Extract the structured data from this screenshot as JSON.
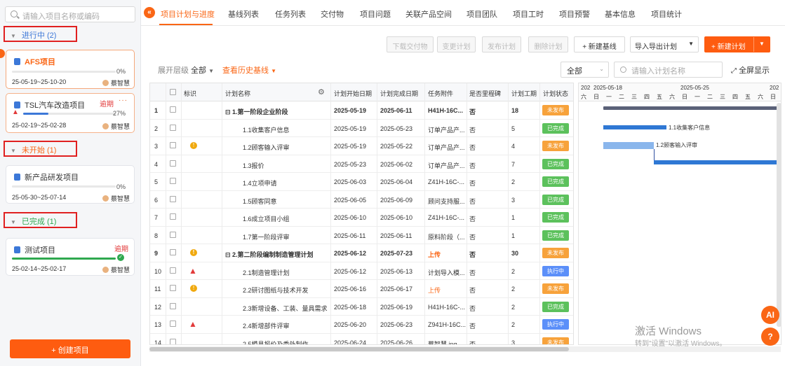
{
  "sidebar": {
    "search_placeholder": "请输入项目名称或编码",
    "groups": [
      {
        "label": "进行中 (2)",
        "color": "#3c78d8"
      },
      {
        "label": "未开始 (1)",
        "color": "#fa6615"
      },
      {
        "label": "已完成 (1)",
        "color": "#2fa84f"
      }
    ],
    "projects": [
      {
        "name": "AFS项目",
        "pct": "0%",
        "progress": 0,
        "dates": "25-05-19~25-10-20",
        "owner": "蔡智慧"
      },
      {
        "name": "TSL汽车改造项目",
        "pct": "27%",
        "progress": 0.27,
        "dates": "25-02-19~25-02-28",
        "owner": "蔡智慧",
        "tag": "逾期",
        "more": "···"
      },
      {
        "name": "新产品研发项目",
        "pct": "0%",
        "progress": 0,
        "dates": "25-05-30~25-07-14",
        "owner": "蔡智慧"
      },
      {
        "name": "测试项目",
        "progress": 1,
        "dates": "25-02-14~25-02-17",
        "owner": "蔡智慧",
        "tag": "逾期"
      }
    ],
    "create_label": "+ 创建项目"
  },
  "tabs": [
    "项目计划与进度",
    "基线列表",
    "任务列表",
    "交付物",
    "项目问题",
    "关联产品空间",
    "项目团队",
    "项目工时",
    "项目预警",
    "基本信息",
    "项目统计"
  ],
  "toolbar": {
    "download": "下载交付物",
    "change": "变更计划",
    "publish": "发布计划",
    "delete": "删除计划",
    "new_baseline": "+ 新建基线",
    "import_export": "导入导出计划",
    "new_plan": "+ 新建计划"
  },
  "filter": {
    "expand_label": "展开层级",
    "expand_value": "全部",
    "history": "查看历史基线",
    "status_value": "全部",
    "search_placeholder": "请输入计划名称",
    "fullscreen": "全屏显示"
  },
  "table": {
    "headers": [
      "",
      "标识",
      "计划名称",
      "计划开始日期",
      "计划完成日期",
      "任务附件",
      "是否里程碑",
      "计划工期",
      "计划状态"
    ],
    "rows": [
      {
        "no": "1",
        "flag": "",
        "name": "⊟ 1.第一阶段企业阶段",
        "start": "2025-05-19",
        "end": "2025-06-11",
        "attach": "H41H-16C...",
        "ms": "否",
        "dur": "18",
        "status": "未发布",
        "parent": true
      },
      {
        "no": "2",
        "flag": "",
        "name": "1.1收集客户信息",
        "start": "2025-05-19",
        "end": "2025-05-23",
        "attach": "订单产品产...",
        "ms": "否",
        "dur": "5",
        "status": "已完成"
      },
      {
        "no": "3",
        "flag": "warn",
        "name": "1.2顾客输入评审",
        "start": "2025-05-19",
        "end": "2025-05-22",
        "attach": "订单产品产...",
        "ms": "否",
        "dur": "4",
        "status": "未发布"
      },
      {
        "no": "4",
        "flag": "",
        "name": "1.3报价",
        "start": "2025-05-23",
        "end": "2025-06-02",
        "attach": "订单产品产...",
        "ms": "否",
        "dur": "7",
        "status": "已完成"
      },
      {
        "no": "5",
        "flag": "",
        "name": "1.4立项申请",
        "start": "2025-06-03",
        "end": "2025-06-04",
        "attach": "Z41H-16C-...",
        "ms": "否",
        "dur": "2",
        "status": "已完成"
      },
      {
        "no": "6",
        "flag": "",
        "name": "1.5顾客同意",
        "start": "2025-06-05",
        "end": "2025-06-09",
        "attach": "顾问支持服...",
        "ms": "否",
        "dur": "3",
        "status": "已完成"
      },
      {
        "no": "7",
        "flag": "",
        "name": "1.6成立项目小组",
        "start": "2025-06-10",
        "end": "2025-06-10",
        "attach": "Z41H-16C-...",
        "ms": "否",
        "dur": "1",
        "status": "已完成"
      },
      {
        "no": "8",
        "flag": "",
        "name": "1.7第一阶段评审",
        "start": "2025-06-11",
        "end": "2025-06-11",
        "attach": "原料阶段（...",
        "ms": "否",
        "dur": "1",
        "status": "已完成"
      },
      {
        "no": "9",
        "flag": "warn",
        "name": "⊟ 2.第二阶段编制制造管理计划",
        "start": "2025-06-12",
        "end": "2025-07-23",
        "attach": "上传",
        "ms": "否",
        "dur": "30",
        "status": "未发布",
        "parent": true
      },
      {
        "no": "10",
        "flag": "danger",
        "name": "2.1制造管理计划",
        "start": "2025-06-12",
        "end": "2025-06-13",
        "attach": "计划导入模...",
        "ms": "否",
        "dur": "2",
        "status": "执行中"
      },
      {
        "no": "11",
        "flag": "warn",
        "name": "2.2研讨图纸与技术开发",
        "start": "2025-06-16",
        "end": "2025-06-17",
        "attach": "上传",
        "ms": "否",
        "dur": "2",
        "status": "未发布"
      },
      {
        "no": "12",
        "flag": "",
        "name": "2.3新增设备、工装、量具需求",
        "start": "2025-06-18",
        "end": "2025-06-19",
        "attach": "H41H-16C-...",
        "ms": "否",
        "dur": "2",
        "status": "已完成"
      },
      {
        "no": "13",
        "flag": "danger",
        "name": "2.4新增部件评审",
        "start": "2025-06-20",
        "end": "2025-06-23",
        "attach": "Z941H-16C...",
        "ms": "否",
        "dur": "2",
        "status": "执行中"
      },
      {
        "no": "14",
        "flag": "",
        "name": "2.5模具报价及委外制作",
        "start": "2025-06-24",
        "end": "2025-06-26",
        "attach": "蔡智慧.jpg",
        "ms": "否",
        "dur": "3",
        "status": "未发布"
      }
    ]
  },
  "status_colors": {
    "未发布": "#f7a23b",
    "已完成": "#5cc15c",
    "执行中": "#5b8ff9"
  },
  "gantt": {
    "year_left": "202",
    "week1": "2025-05-18",
    "week2": "2025-05-25",
    "year_right": "202",
    "days": [
      "六",
      "日",
      "一",
      "二",
      "三",
      "四",
      "五",
      "六",
      "日",
      "一",
      "二",
      "三",
      "四",
      "五",
      "六",
      "日"
    ],
    "labels": [
      "1.1收集客户信息",
      "1.2顾客输入评审"
    ]
  },
  "watermark": {
    "line1": "激活 Windows",
    "line2": "转到\"设置\"以激活 Windows。"
  },
  "fab": {
    "ai": "AI",
    "help": "?"
  }
}
